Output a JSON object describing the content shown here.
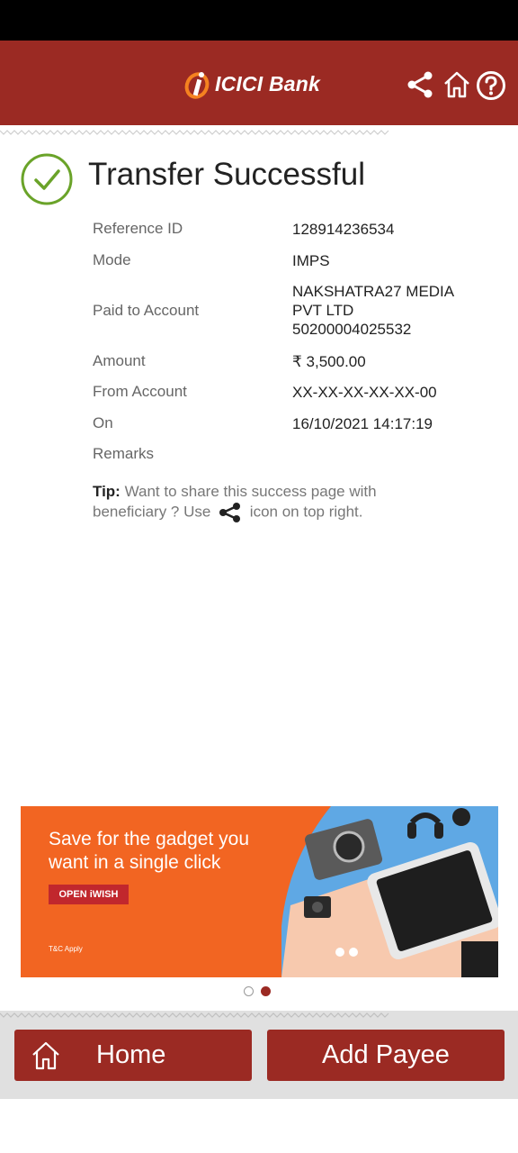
{
  "header": {
    "brand_name": "ICICI",
    "brand_suffix": "Bank",
    "icons": [
      "share-icon",
      "home-icon",
      "help-icon"
    ]
  },
  "result": {
    "title": "Transfer Successful",
    "status_color": "#6aa329"
  },
  "details": {
    "reference_id_label": "Reference ID",
    "reference_id_value": "128914236534",
    "mode_label": "Mode",
    "mode_value": "IMPS",
    "paid_to_label": "Paid to Account",
    "paid_to_line1": "NAKSHATRA27 MEDIA",
    "paid_to_line2": "PVT LTD",
    "paid_to_line3": "50200004025532",
    "amount_label": "Amount",
    "amount_value": "₹ 3,500.00",
    "from_account_label": "From Account",
    "from_account_value": "XX-XX-XX-XX-XX-00",
    "on_label": "On",
    "on_value": "16/10/2021 14:17:19",
    "remarks_label": "Remarks"
  },
  "tip": {
    "prefix": "Tip:",
    "text_before": " Want to share this success page with beneficiary ? Use ",
    "text_after": " icon on top right."
  },
  "banner": {
    "headline": "Save for the gadget you want in a single click",
    "button_label": "OPEN iWISH",
    "tnc": "T&C Apply",
    "background_color": "#f26522"
  },
  "carousel": {
    "total": 2,
    "active": 2
  },
  "footer": {
    "home_label": "Home",
    "add_payee_label": "Add Payee"
  },
  "colors": {
    "brand": "#9b2a23",
    "footer_bg": "#e0e0e0"
  }
}
